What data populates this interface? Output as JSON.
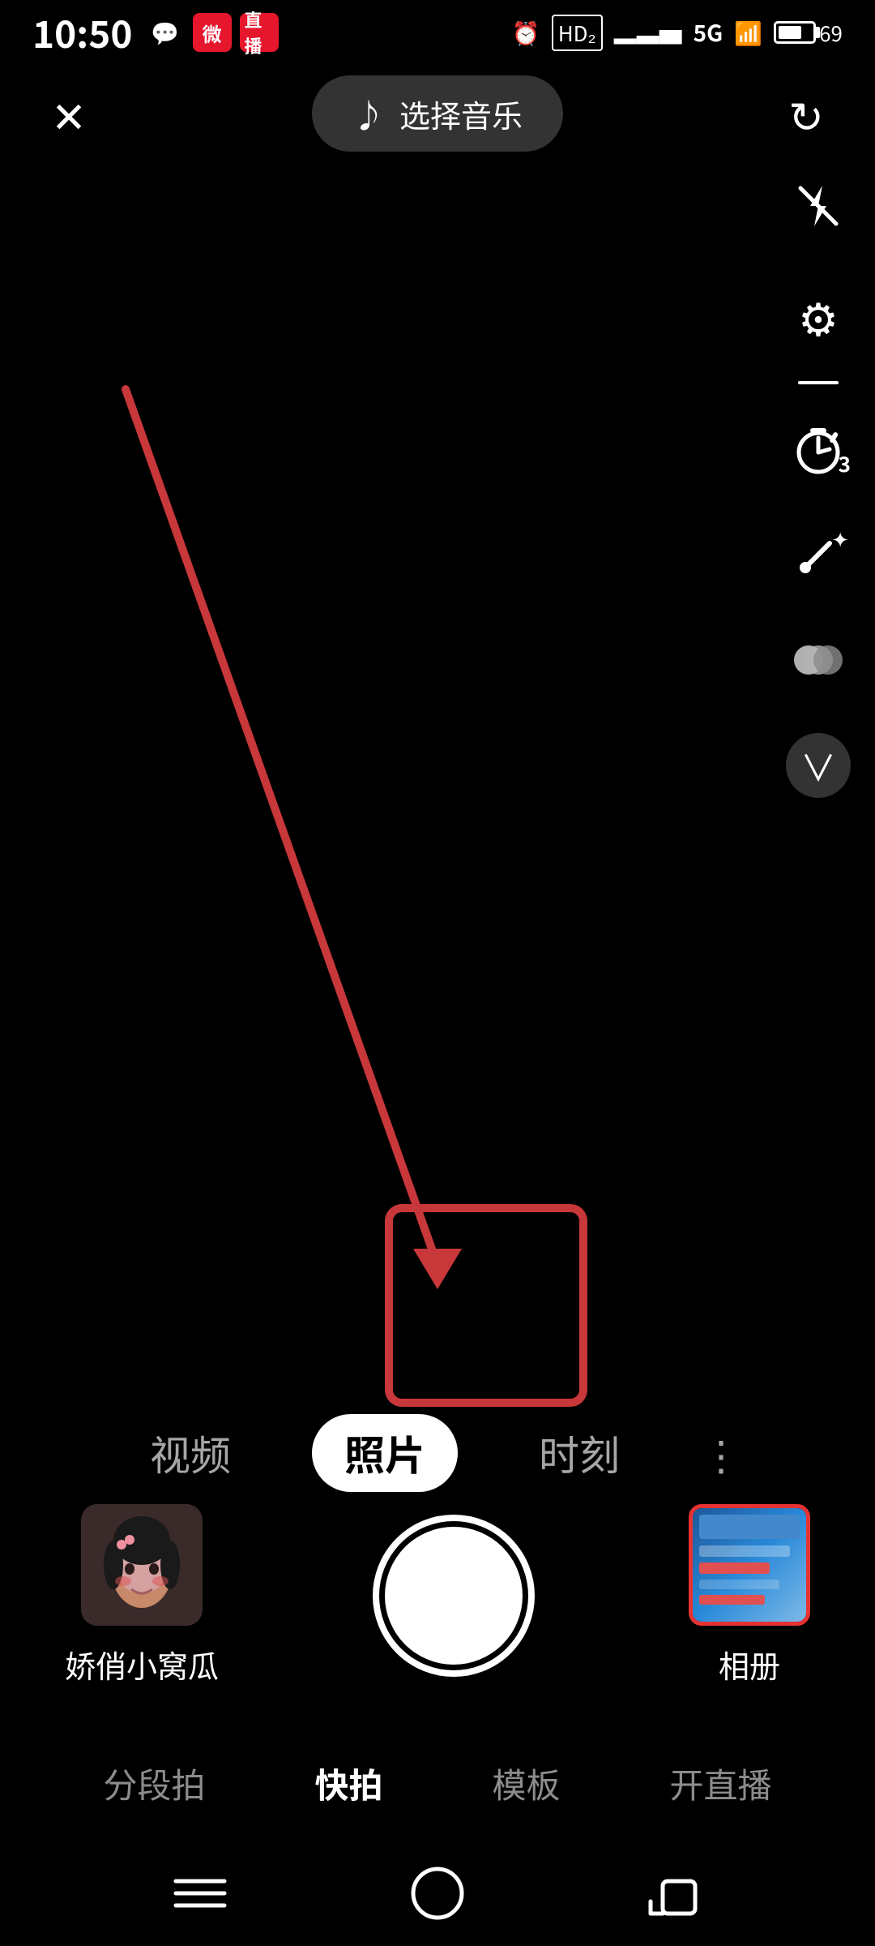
{
  "status": {
    "time": "10:50",
    "battery": "69",
    "network": "5G",
    "signal": "HD2"
  },
  "topbar": {
    "close_label": "✕",
    "music_label": "选择音乐",
    "music_note": "♪",
    "refresh_label": "↻"
  },
  "toolbar": {
    "flash_icon": "⚡",
    "gear_icon": "⚙",
    "timer_icon": "⏱",
    "timer_num": "3",
    "beauty_icon": "✏",
    "expand_icon": "❯"
  },
  "mode_tabs": {
    "video": "视频",
    "photo": "照片",
    "moment": "时刻"
  },
  "bottom": {
    "user_name": "娇俏小窝瓜",
    "album_label": "相册"
  },
  "bottom_modes": {
    "segment": "分段拍",
    "quick": "快拍",
    "template": "模板",
    "live": "开直播"
  },
  "annotation": {
    "arrow_color": "#c8373a"
  }
}
